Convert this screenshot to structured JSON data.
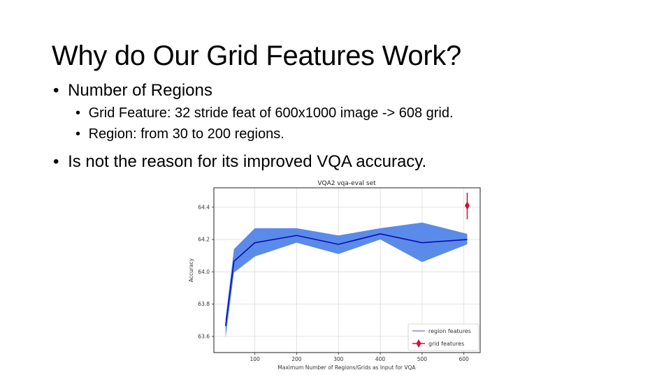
{
  "slide": {
    "title": "Why do Our Grid Features Work?",
    "bullets": [
      {
        "level": 1,
        "marker": "•",
        "text": "Number of Regions"
      },
      {
        "level": 2,
        "marker": "•",
        "text": "Grid Feature: 32 stride feat of 600x1000 image -> 608 grid."
      },
      {
        "level": 2,
        "marker": "•",
        "text": "Region: from 30 to 200 regions."
      },
      {
        "level": 1,
        "marker": "•",
        "text": "Is not the reason for its improved VQA accuracy."
      }
    ]
  },
  "chart_data": {
    "type": "line",
    "title": "VQA2 vqa-eval set",
    "xlabel": "Maximum Number of Regions/Grids as Input for VQA",
    "ylabel": "Accuracy",
    "xlim": [
      2,
      639
    ],
    "ylim": [
      63.5,
      64.52
    ],
    "xticks": [
      100,
      200,
      300,
      400,
      500,
      600
    ],
    "xtick_labels": [
      "100",
      "200",
      "300",
      "400",
      "500",
      "600"
    ],
    "yticks": [
      63.6,
      63.8,
      64.0,
      64.2,
      64.4
    ],
    "ytick_labels": [
      "63.6",
      "63.8",
      "64.0",
      "64.2",
      "64.4"
    ],
    "grid": true,
    "legend": "bottom-right",
    "colors": {
      "region_line": "#0a0ab4",
      "region_band": "#5b8be8",
      "region_legend": "#8a8ad0",
      "grid_point": "#d0103a"
    },
    "series": [
      {
        "name": "region features",
        "x": [
          30,
          50,
          100,
          200,
          300,
          400,
          500,
          608
        ],
        "y": [
          63.665,
          64.065,
          64.18,
          64.225,
          64.17,
          64.235,
          64.18,
          64.2
        ],
        "upper": [
          63.71,
          64.14,
          64.27,
          64.27,
          64.225,
          64.27,
          64.305,
          64.235
        ],
        "lower": [
          63.59,
          63.995,
          64.095,
          64.18,
          64.11,
          64.2,
          64.06,
          64.17
        ]
      },
      {
        "name": "grid features",
        "x": [
          608
        ],
        "y": [
          64.41
        ],
        "err_low": [
          64.325
        ],
        "err_high": [
          64.49
        ]
      }
    ]
  }
}
